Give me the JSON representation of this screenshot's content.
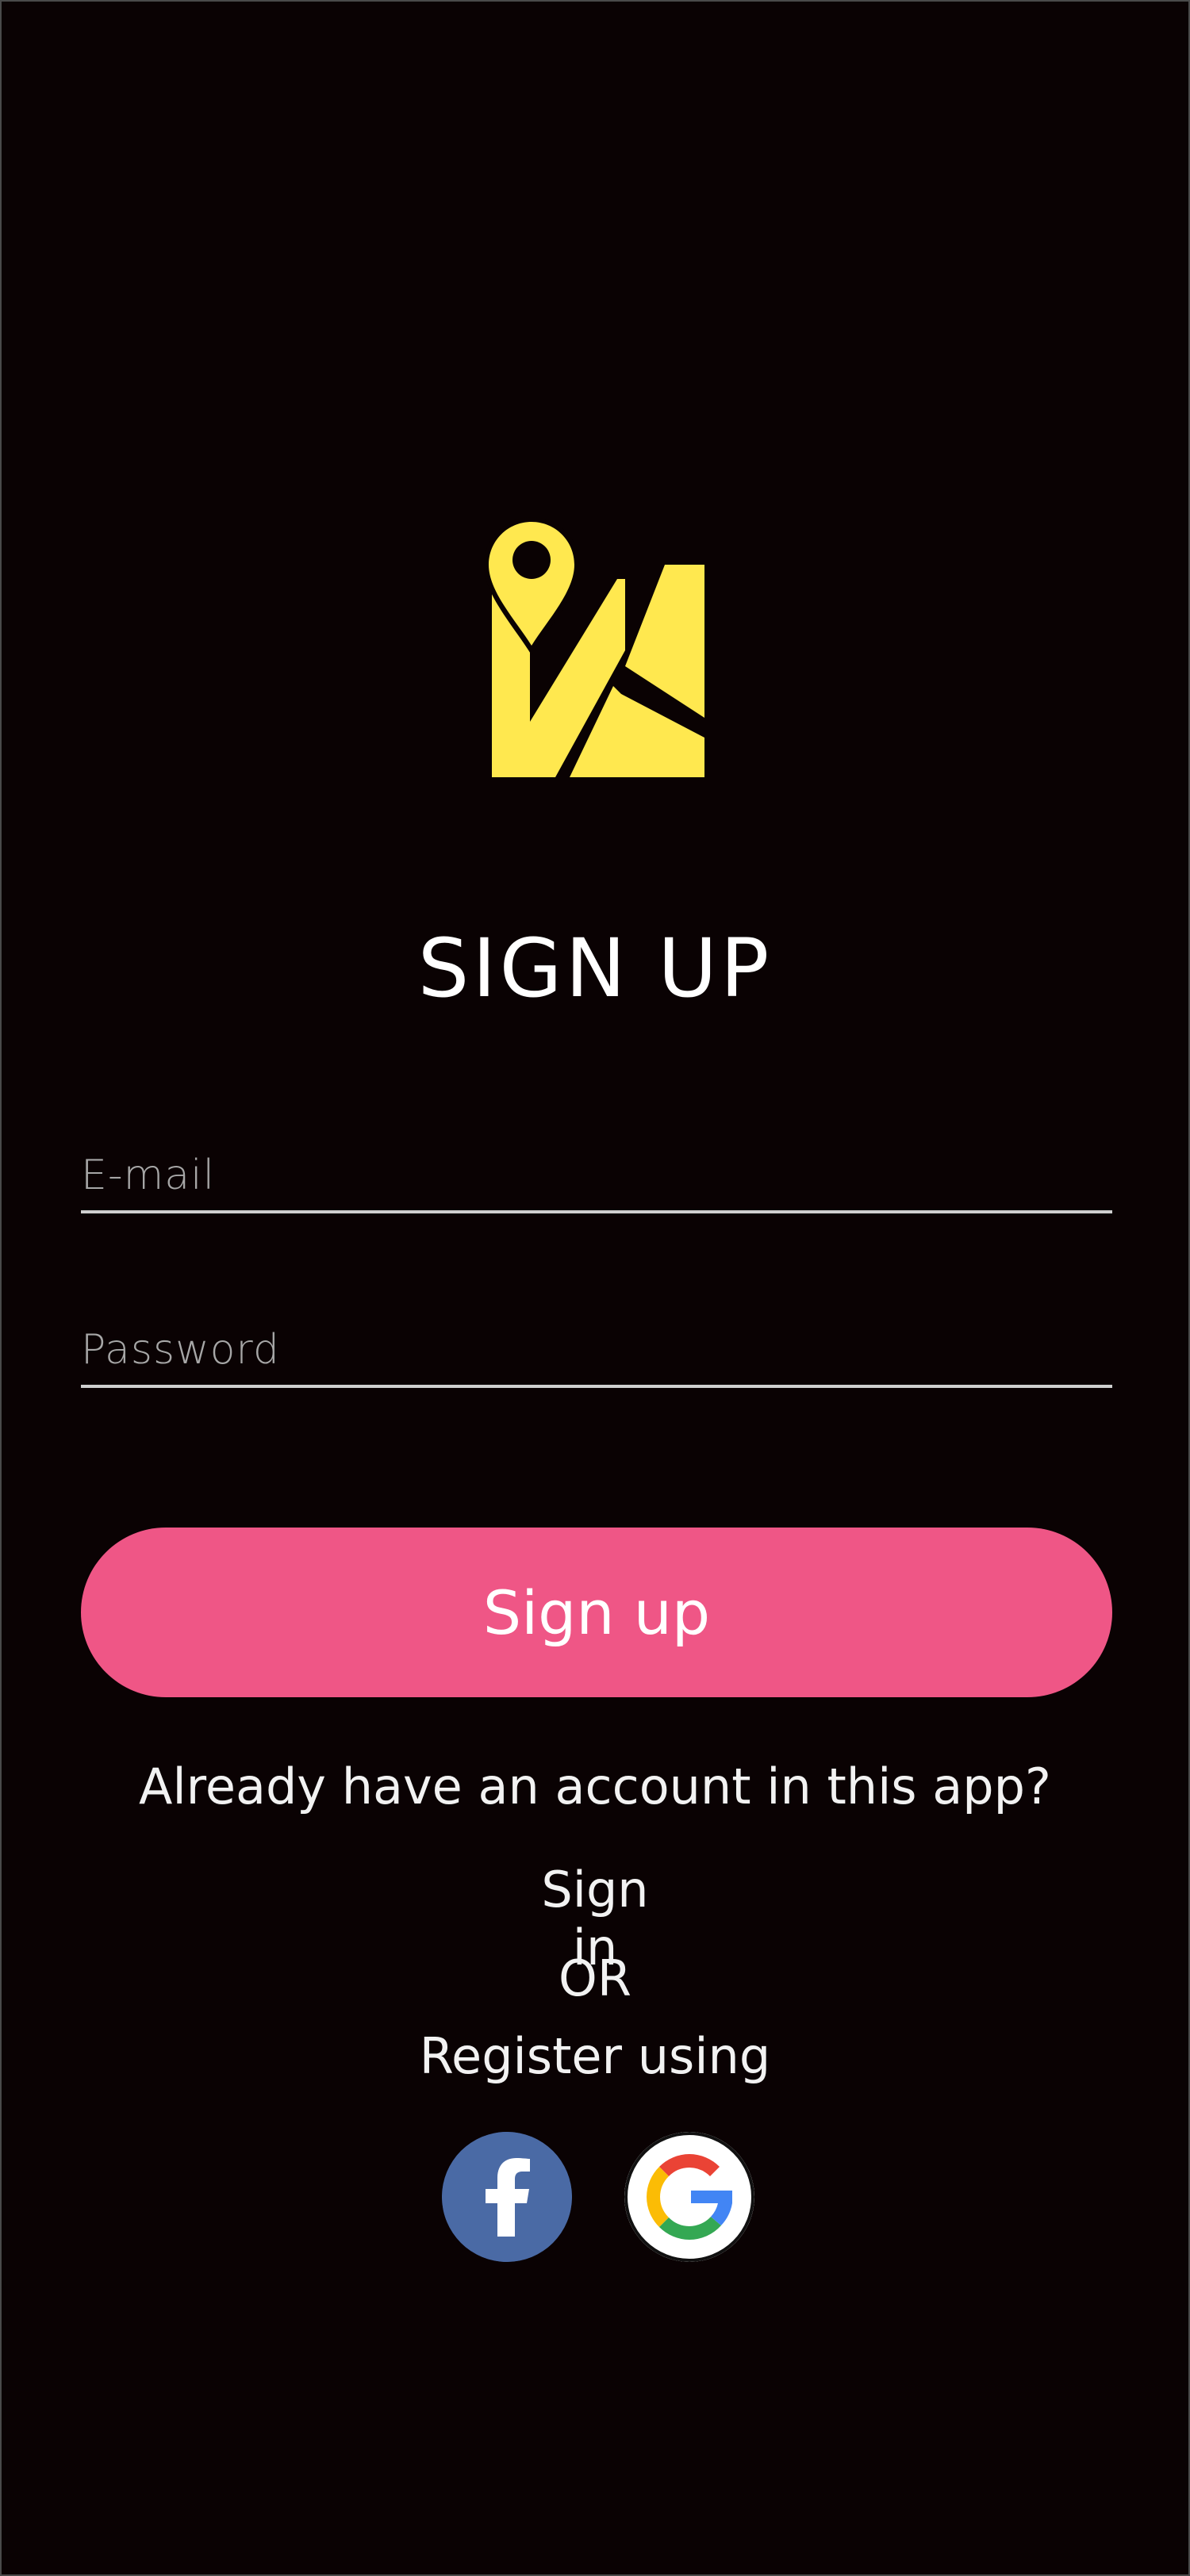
{
  "header": {
    "title": "SIGN UP"
  },
  "form": {
    "email_placeholder": "E-mail",
    "email_value": "",
    "password_placeholder": "Password",
    "password_value": "",
    "submit_label": "Sign up"
  },
  "footer": {
    "already_text": "Already have an account in this app?",
    "signin_label": "Sign in",
    "or_text": "OR",
    "register_text": "Register using"
  },
  "icons": {
    "logo": "map-pin-logo-icon",
    "facebook": "facebook-icon",
    "google": "google-icon"
  },
  "colors": {
    "background": "#0a0203",
    "logo": "#ffe84f",
    "button": "#ef5686",
    "facebook": "#4a6aa5",
    "field_underline": "#cfcfcf",
    "placeholder": "#a7a7a7"
  }
}
